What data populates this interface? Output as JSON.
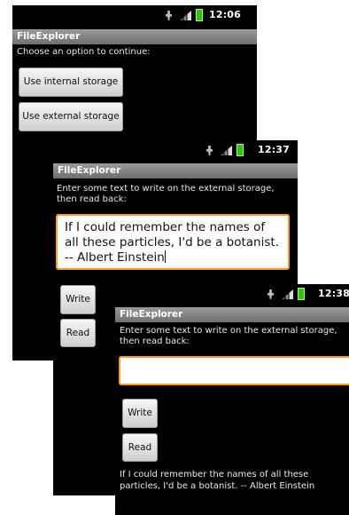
{
  "screens": {
    "first": {
      "time": "12:06",
      "app_title": "FileExplorer",
      "prompt": "Choose an option to continue:",
      "internal_btn": "Use internal storage",
      "external_btn": "Use external storage"
    },
    "second": {
      "time": "12:37",
      "app_title": "FileExplorer",
      "prompt_line1": "Enter some text to write on the external storage,",
      "prompt_line2": "then read back:",
      "input_value": "If I could remember the names of\nall these particles, I'd be a botanist.\n-- Albert Einstein",
      "write_btn": "Write",
      "read_btn": "Read"
    },
    "third": {
      "time": "12:38",
      "app_title": "FileExplorer",
      "prompt_line1": "Enter some text to write on the external storage,",
      "prompt_line2": "then read back:",
      "input_value": "",
      "write_btn": "Write",
      "read_btn": "Read",
      "output_line1": "If I could remember the names of all these",
      "output_line2": "particles, I'd be a botanist. -- Albert Einstein"
    }
  },
  "icons": [
    "usb-icon",
    "signal-icon",
    "battery-icon"
  ],
  "colors": {
    "focus_border": "#ff9a1f",
    "battery": "#34c200",
    "title_bar": "#7e7e7e"
  }
}
